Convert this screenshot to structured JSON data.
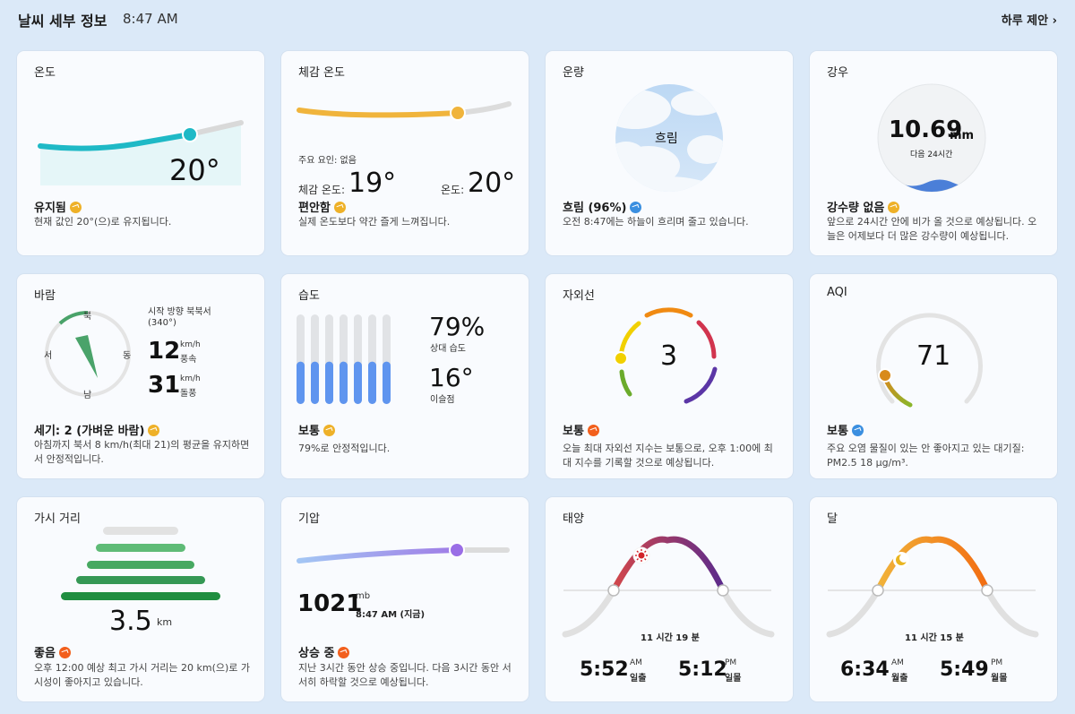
{
  "header": {
    "title": "날씨 세부 정보",
    "time": "8:47 AM",
    "link": "하루 제안",
    "link_chevron": "›"
  },
  "cards": {
    "temperature": {
      "title": "온도",
      "value": "20°",
      "status": "유지됨",
      "desc": "현재 값인 20°(으)로 유지됩니다.",
      "status_icon": "steady-trend-icon",
      "accent": "#1fb9c6"
    },
    "feels_like": {
      "title": "체감 온도",
      "factor": "주요 요인: 없음",
      "feels_label": "체감 온도:",
      "feels_value": "19°",
      "temp_label": "온도:",
      "temp_value": "20°",
      "status": "편안함",
      "desc": "실제 온도보다 약간 즐게 느껴집니다.",
      "accent": "#f0b43c"
    },
    "cloud": {
      "title": "운량",
      "center_label": "흐림",
      "status": "흐림 (96%)",
      "desc": "오전 8:47에는 하늘이 흐리며 줄고 있습니다.",
      "status_icon": "decreasing-trend-icon"
    },
    "precip": {
      "title": "강우",
      "value": "10.69",
      "unit": "mm",
      "period": "다음 24시간",
      "status": "강수량 없음",
      "desc": "앞으로 24시간 안에 비가 올 것으로 예상됩니다. 오늘은 어제보다 더 많은 강수량이 예상됩니다."
    },
    "wind": {
      "title": "바람",
      "direction_label": "시작 방향 북북서",
      "direction_deg": "(340°)",
      "north": "북",
      "south": "남",
      "east": "동",
      "west": "서",
      "speed_value": "12",
      "speed_unit": "km/h",
      "speed_label": "풍속",
      "gust_value": "31",
      "gust_unit": "km/h",
      "gust_label": "돌풍",
      "status": "세기: 2 (가벼운 바람)",
      "desc": "아침까지 북서 8 km/h(최대 21)의 평균을 유지하면서 안정적입니다."
    },
    "humidity": {
      "title": "습도",
      "value": "79%",
      "value_label": "상대 습도",
      "dew_value": "16°",
      "dew_label": "이슬점",
      "status": "보통",
      "desc": "79%로 안정적입니다.",
      "level": 0.79
    },
    "uv": {
      "title": "자외선",
      "value": "3",
      "status": "보통",
      "desc": "오늘 최대 자외선 지수는 보통으로, 오후 1:00에 최대 지수를 기록할 것으로 예상됩니다."
    },
    "aqi": {
      "title": "AQI",
      "value": "71",
      "status": "보통",
      "desc": "주요 오염 물질이 있는 안 좋아지고 있는 대기질: PM2.5 18 µg/m³."
    },
    "visibility": {
      "title": "가시 거리",
      "value": "3.5",
      "unit": "km",
      "status": "좋음",
      "desc": "오후 12:00 예상 최고 가시 거리는 20 km(으)로 가시성이 좋아지고 있습니다."
    },
    "pressure": {
      "title": "기압",
      "value": "1021",
      "unit": "mb",
      "time": "8:47 AM (지금)",
      "status": "상승 중",
      "desc": "지난 3시간 동안 상승 중입니다. 다음 3시간 동안 서서히 하락할 것으로 예상됩니다."
    },
    "sun": {
      "title": "태양",
      "duration": "11 시간 19 분",
      "rise_time": "5:52",
      "rise_ampm": "AM",
      "rise_label": "일출",
      "set_time": "5:12",
      "set_ampm": "PM",
      "set_label": "일몰"
    },
    "moon": {
      "title": "달",
      "duration": "11 시간 15 분",
      "rise_time": "6:34",
      "rise_ampm": "AM",
      "rise_label": "월출",
      "set_time": "5:49",
      "set_ampm": "PM",
      "set_label": "월몰"
    }
  }
}
